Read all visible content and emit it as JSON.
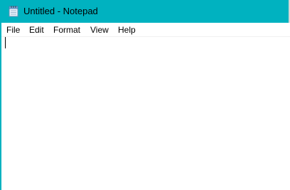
{
  "window": {
    "title": "Untitled - Notepad",
    "accent_color": "#00b2c0",
    "icon": "notepad-icon"
  },
  "menu": {
    "items": [
      {
        "label": "File"
      },
      {
        "label": "Edit"
      },
      {
        "label": "Format"
      },
      {
        "label": "View"
      },
      {
        "label": "Help"
      }
    ]
  },
  "editor": {
    "content": ""
  }
}
